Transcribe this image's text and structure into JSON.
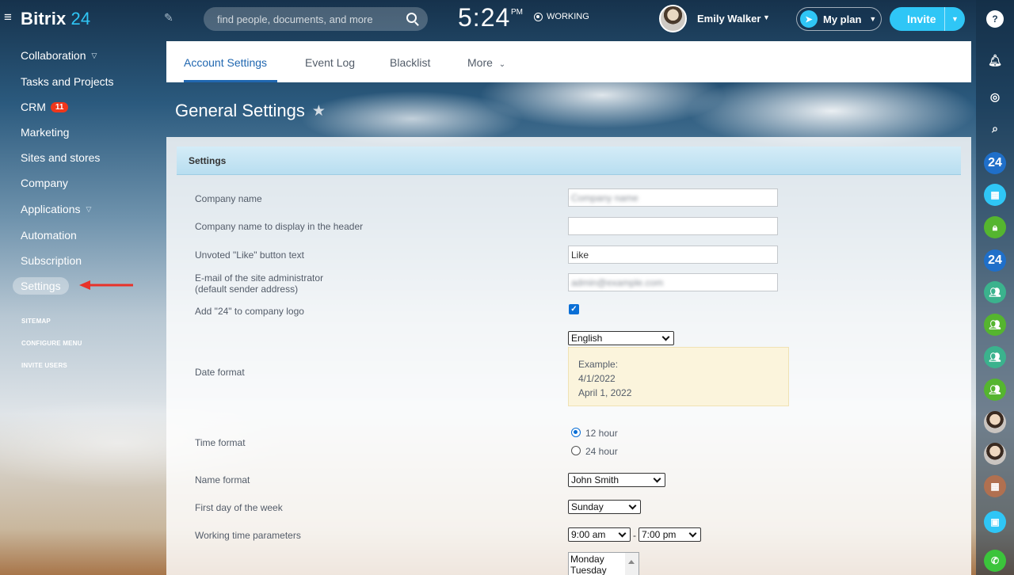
{
  "header": {
    "logo_text": "Bitrix",
    "logo_number": "24",
    "search_placeholder": "find people, documents, and more",
    "clock": "5:24",
    "ampm": "PM",
    "working_status": "WORKING",
    "user_name": "Emily Walker",
    "myplan_label": "My plan",
    "invite_label": "Invite"
  },
  "sidebar": {
    "items": [
      {
        "label": "Collaboration",
        "chevron": true
      },
      {
        "label": "Tasks and Projects"
      },
      {
        "label": "CRM",
        "badge": "11"
      },
      {
        "label": "Marketing"
      },
      {
        "label": "Sites and stores"
      },
      {
        "label": "Company"
      },
      {
        "label": "Applications",
        "chevron": true
      },
      {
        "label": "Automation"
      },
      {
        "label": "Subscription"
      },
      {
        "label": "Settings",
        "active": true
      }
    ],
    "links": [
      "SITEMAP",
      "CONFIGURE MENU",
      "INVITE USERS"
    ]
  },
  "tabs": [
    "Account Settings",
    "Event Log",
    "Blacklist",
    "More"
  ],
  "page_title": "General Settings",
  "settings": {
    "section_title": "Settings",
    "company_name_label": "Company name",
    "company_name_value": "Company name",
    "header_name_label": "Company name to display in the header",
    "header_name_value": "",
    "like_label": "Unvoted \"Like\" button text",
    "like_value": "Like",
    "email_label_1": "E-mail of the site administrator",
    "email_label_2": "(default sender address)",
    "email_value": "admin@example.com",
    "logo24_label": "Add \"24\" to company logo",
    "date_format_label": "Date format",
    "date_format_value": "English",
    "example_title": "Example:",
    "example_short": "4/1/2022",
    "example_long": "April 1, 2022",
    "time_format_label": "Time format",
    "time_12": "12 hour",
    "time_24": "24 hour",
    "name_format_label": "Name format",
    "name_format_value": "John Smith",
    "first_day_label": "First day of the week",
    "first_day_value": "Sunday",
    "working_time_label": "Working time parameters",
    "work_start": "9:00 am",
    "work_end": "7:00 pm",
    "weekdays": [
      "Monday",
      "Tuesday"
    ]
  },
  "rail": {
    "help": "?",
    "num24": "24"
  },
  "colors": {
    "accent": "#2fc6f6",
    "active_tab": "#2067b0",
    "badge": "#f0371b"
  }
}
